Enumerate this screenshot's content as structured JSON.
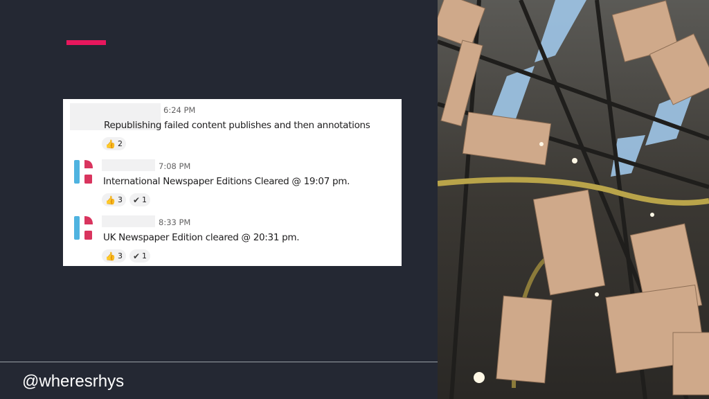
{
  "colors": {
    "background": "#242833",
    "accent": "#e8175d",
    "card": "#ffffff"
  },
  "messages": [
    {
      "time": "6:24 PM",
      "text": "Republishing failed content publishes and then annotations",
      "reactions": [
        {
          "icon": "thumbs-up-icon",
          "emoji": "👍",
          "count": "2"
        }
      ]
    },
    {
      "time": "7:08 PM",
      "text": "International Newspaper Editions Cleared @ 19:07 pm.",
      "reactions": [
        {
          "icon": "thumbs-up-icon",
          "emoji": "👍",
          "count": "3"
        },
        {
          "icon": "check-mark-icon",
          "emoji": "✔",
          "count": "1"
        }
      ]
    },
    {
      "time": "8:33 PM",
      "text": "UK Newspaper Edition cleared @ 20:31 pm.",
      "reactions": [
        {
          "icon": "thumbs-up-icon",
          "emoji": "👍",
          "count": "3"
        },
        {
          "icon": "check-mark-icon",
          "emoji": "✔",
          "count": "1"
        }
      ]
    }
  ],
  "footer": {
    "handle": "@wheresrhys"
  }
}
